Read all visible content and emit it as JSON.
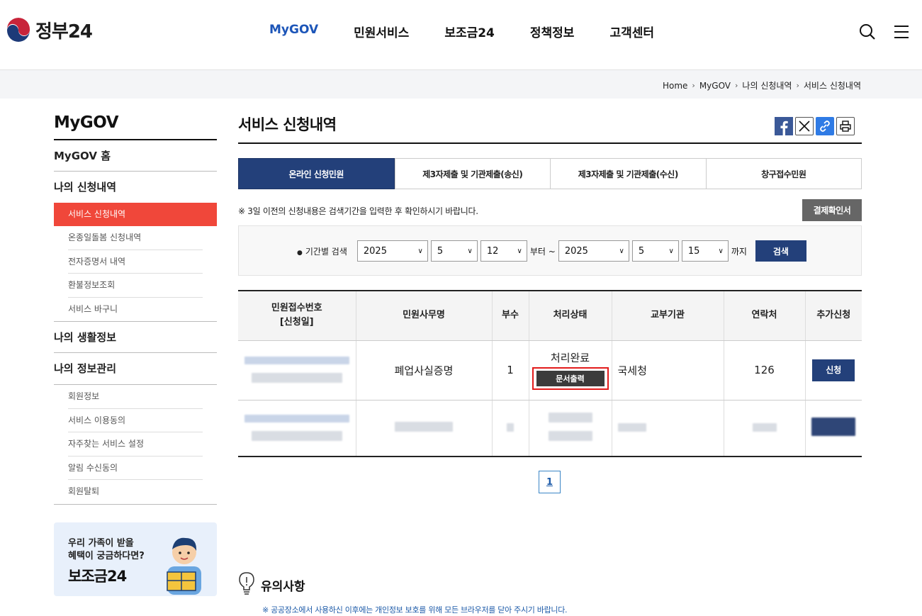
{
  "header": {
    "logo_text": "정부24",
    "nav": [
      "MyGOV",
      "민원서비스",
      "보조금24",
      "정책정보",
      "고객센터"
    ],
    "active_nav": "MyGOV",
    "search_icon": "search-icon",
    "menu_icon": "hamburger-menu-icon"
  },
  "breadcrumb": [
    "Home",
    "MyGOV",
    "나의 신청내역",
    "서비스 신청내역"
  ],
  "sidebar": {
    "title": "MyGOV",
    "home": "MyGOV 홈",
    "group1": {
      "label": "나의 신청내역",
      "items": [
        "서비스 신청내역",
        "온종일돌봄 신청내역",
        "전자증명서 내역",
        "환불정보조회",
        "서비스 바구니"
      ]
    },
    "group2": {
      "label": "나의 생활정보"
    },
    "group3": {
      "label": "나의 정보관리",
      "items": [
        "회원정보",
        "서비스 이용동의",
        "자주찾는 서비스 설정",
        "알림 수신동의",
        "회원탈퇴"
      ]
    },
    "banner": {
      "line1": "우리 가족이 받을",
      "line2": "혜택이 궁금하다면?",
      "line3": "보조금24"
    }
  },
  "main": {
    "title": "서비스 신청내역",
    "share_icons": [
      "facebook-icon",
      "x-icon",
      "link-icon",
      "print-icon"
    ],
    "tabs": [
      "온라인 신청민원",
      "제3자제출 및 기관제출(송신)",
      "제3자제출 및 기관제출(수신)",
      "창구접수민원"
    ],
    "active_tab": 0,
    "notice": "※ 3일 이전의 신청내용은 검색기간을 입력한 후 확인하시기 바랍니다.",
    "pay_button": "결제확인서",
    "search": {
      "label": "기간별 검색",
      "from_year": "2025",
      "from_month": "5",
      "from_day": "12",
      "from_suffix": "부터 ~",
      "to_year": "2025",
      "to_month": "5",
      "to_day": "15",
      "to_suffix": "까지",
      "button": "검색"
    },
    "table": {
      "headers": [
        "민원접수번호",
        "[신청일]",
        "민원사무명",
        "부수",
        "처리상태",
        "교부기관",
        "연락처",
        "추가신청"
      ],
      "row1": {
        "service": "폐업사실증명",
        "copies": "1",
        "status": "처리완료",
        "print_button": "문서출력",
        "agency": "국세청",
        "contact": "126",
        "apply_button": "신청"
      }
    },
    "pagination": [
      "1"
    ],
    "caution": {
      "title": "유의사항",
      "text": "※ 공공장소에서 사용하신 이후에는 개인정보 보호를 위해 모든 브라우저를 닫아 주시기 바랍니다."
    }
  },
  "colors": {
    "accent_navy": "#23407a",
    "nav_active": "#1c55b8",
    "sidebar_active": "#f0473a",
    "highlight_box": "#e21b1b"
  }
}
